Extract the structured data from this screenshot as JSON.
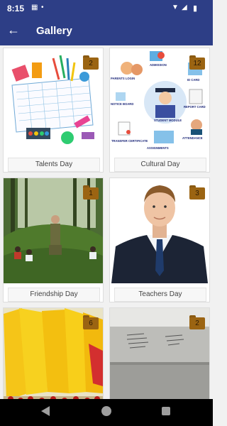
{
  "status_bar": {
    "time": "8:15"
  },
  "header": {
    "title": "Gallery",
    "back_icon": "arrow-left-icon"
  },
  "albums": [
    {
      "title": "Talents Day",
      "count": "2"
    },
    {
      "title": "Cultural Day",
      "count": "12",
      "image_text": [
        "PARENTS LOGIN",
        "ADMISSION",
        "ID CARD",
        "NOTICE BOARD",
        "STUDENT MODULE",
        "REPORT CARD",
        "TRANSFER CERTIFICATE",
        "ASSIGNMENTS",
        "ATTENDANCE"
      ]
    },
    {
      "title": "Friendship Day",
      "count": "1"
    },
    {
      "title": "Teachers Day",
      "count": "3"
    },
    {
      "title": "",
      "count": "6"
    },
    {
      "title": "",
      "count": "2"
    }
  ],
  "colors": {
    "primary": "#2d3e86",
    "badge": "#9b6412",
    "background": "#f1f1f1"
  }
}
